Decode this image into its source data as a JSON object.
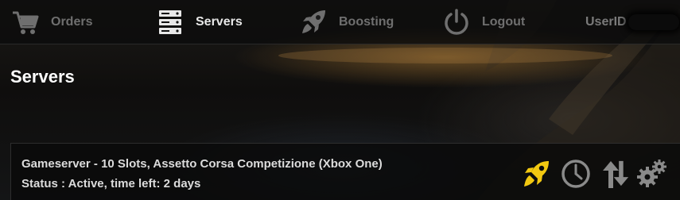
{
  "colors": {
    "accent": "#f2c811",
    "nav_inactive": "#6f6f6f",
    "nav_active": "#e8e8e8",
    "card_text": "#dcdcdc"
  },
  "nav": {
    "items": [
      {
        "label": "Orders",
        "icon": "cart-icon",
        "active": false
      },
      {
        "label": "Servers",
        "icon": "server-icon",
        "active": true
      },
      {
        "label": "Boosting",
        "icon": "rocket-icon",
        "active": false
      },
      {
        "label": "Logout",
        "icon": "power-icon",
        "active": false
      }
    ],
    "user_label": "UserID"
  },
  "page": {
    "title": "Servers"
  },
  "servers": [
    {
      "name": "Gameserver - 10 Slots, Assetto Corsa Competizione (Xbox One)",
      "status": "Status : Active, time left: 2 days",
      "actions": [
        "rocket-icon",
        "clock-icon",
        "up-down-arrows-icon",
        "gears-icon"
      ]
    }
  ]
}
